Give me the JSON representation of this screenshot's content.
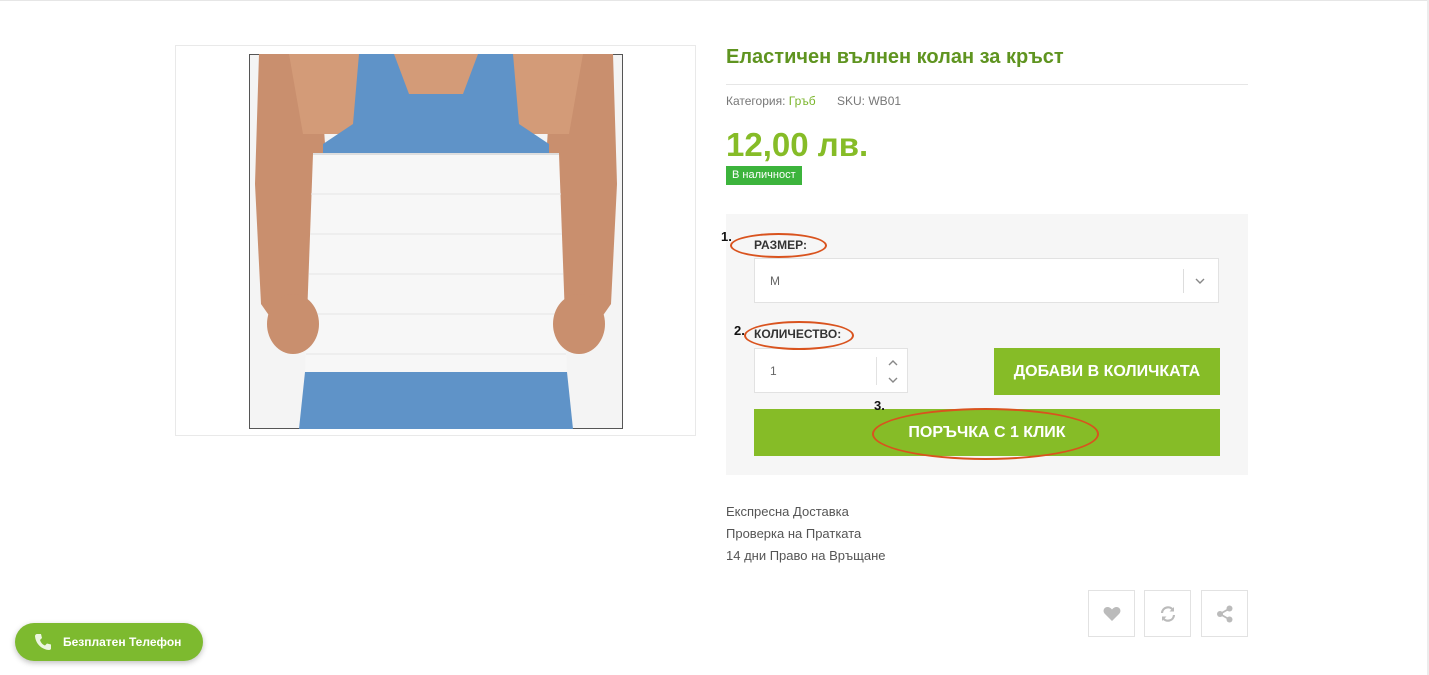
{
  "product": {
    "title": "Еластичен вълнен колан за кръст",
    "category_label": "Категория:",
    "category_value": "Гръб",
    "sku_label": "SKU:",
    "sku_value": "WB01",
    "price": "12,00 лв.",
    "stock_badge": "В наличност",
    "image_icon": "waist-belt-photo"
  },
  "options": {
    "size_label": "РАЗМЕР:",
    "size_value": "M",
    "quantity_label": "КОЛИЧЕСТВО:",
    "quantity_value": "1",
    "add_to_cart_label": "ДОБАВИ В КОЛИЧКАТА",
    "one_click_label": "ПОРЪЧКА С 1 КЛИК"
  },
  "annotations": {
    "n1": "1.",
    "n2": "2.",
    "n3": "3."
  },
  "benefits": [
    "Експресна Доставка",
    "Проверка на Пратката",
    "14 дни Право на Връщане"
  ],
  "actions": {
    "icons": [
      "heart-icon",
      "compare-icon",
      "share-icon"
    ]
  },
  "phone": {
    "label": "Безплатен Телефон",
    "icon": "phone-icon"
  },
  "colors": {
    "accent": "#86bc27",
    "title": "#5f9420",
    "stock": "#3cb43c",
    "annotation": "#d9531e"
  }
}
